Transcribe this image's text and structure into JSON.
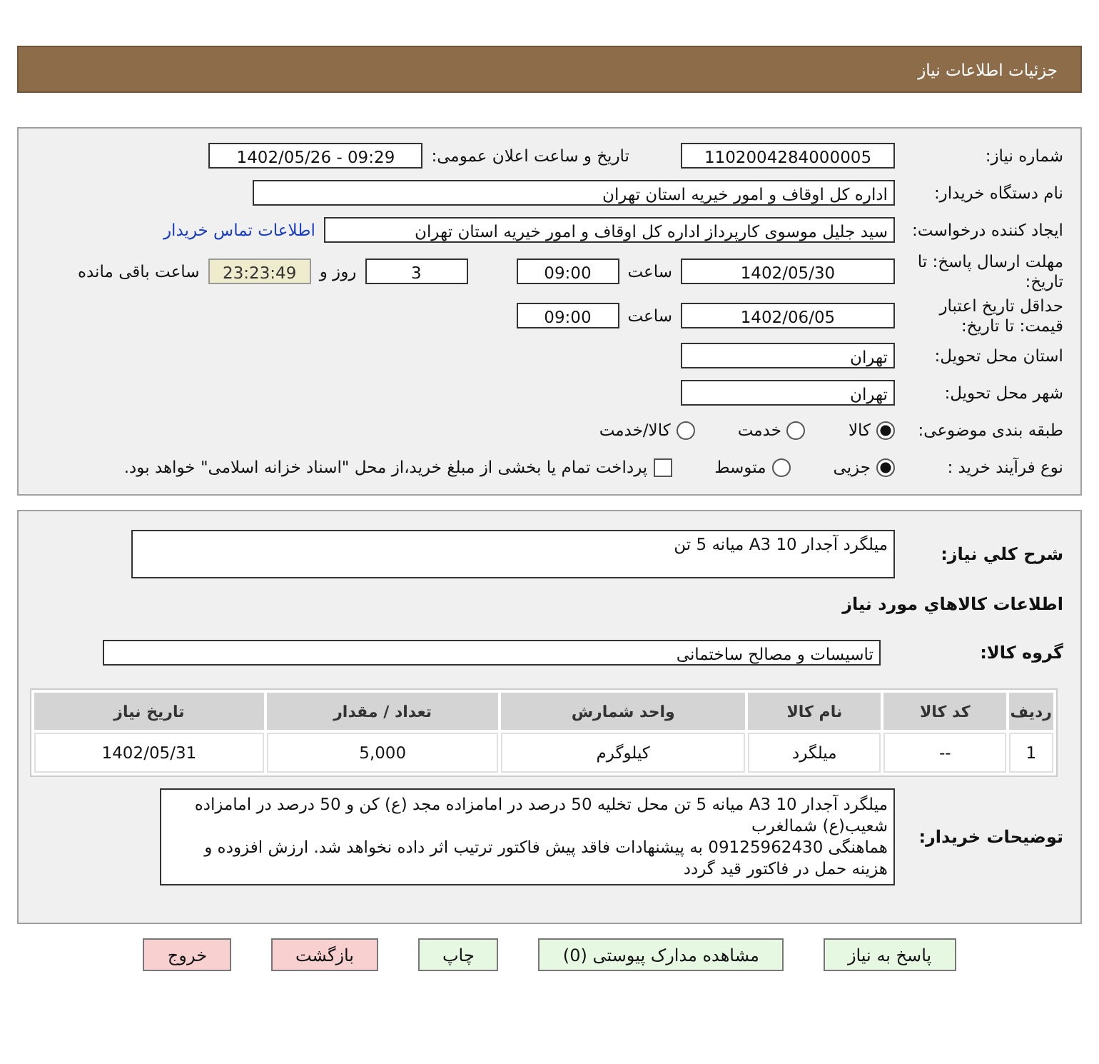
{
  "header": {
    "title": "جزئیات اطلاعات نیاز"
  },
  "details": {
    "need_number": {
      "label": "شماره نیاز:",
      "value": "1102004284000005"
    },
    "announce": {
      "label": "تاریخ و ساعت اعلان عمومی:",
      "value": "1402/05/26 - 09:29"
    },
    "buyer": {
      "label": "نام دستگاه خریدار:",
      "value": "اداره کل اوقاف و امور خیریه استان تهران"
    },
    "requester": {
      "label": "ایجاد کننده درخواست:",
      "value": "سید جلیل موسوی کارپرداز اداره کل اوقاف و امور خیریه استان تهران",
      "link": "اطلاعات تماس خریدار"
    },
    "deadline": {
      "label": "مهلت ارسال پاسخ: تا تاریخ:",
      "date": "1402/05/30",
      "time_label": "ساعت",
      "time": "09:00",
      "days": "3",
      "days_label": "روز و",
      "remaining": "23:23:49",
      "remaining_label": "ساعت باقی مانده"
    },
    "validity": {
      "label": "حداقل تاریخ اعتبار قیمت: تا تاریخ:",
      "date": "1402/06/05",
      "time_label": "ساعت",
      "time": "09:00"
    },
    "province": {
      "label": "استان محل تحویل:",
      "value": "تهران"
    },
    "city": {
      "label": "شهر محل تحویل:",
      "value": "تهران"
    },
    "category": {
      "label": "طبقه بندی موضوعی:",
      "options": [
        {
          "label": "کالا",
          "selected": true
        },
        {
          "label": "خدمت",
          "selected": false
        },
        {
          "label": "کالا/خدمت",
          "selected": false
        }
      ]
    },
    "process": {
      "label": "نوع فرآیند خرید :",
      "options": [
        {
          "label": "جزیی",
          "selected": true
        },
        {
          "label": "متوسط",
          "selected": false
        }
      ],
      "payment": {
        "label": "پرداخت تمام یا بخشی از مبلغ خرید،از محل \"اسناد خزانه اسلامی\" خواهد بود.",
        "checked": false
      }
    }
  },
  "summary": {
    "label": "شرح کلي نياز:",
    "value": "میلگرد آجدار A3 10   میانه 5 تن"
  },
  "items_title": "اطلاعات کالاهاي مورد نياز",
  "group": {
    "label": "گروه کالا:",
    "value": "تاسیسات و مصالح ساختمانی"
  },
  "table": {
    "columns": [
      "ردیف",
      "کد کالا",
      "نام کالا",
      "واحد شمارش",
      "تعداد / مقدار",
      "تاریخ نیاز"
    ],
    "rows": [
      [
        "1",
        "--",
        "میلگرد",
        "کیلوگرم",
        "5,000",
        "1402/05/31"
      ]
    ]
  },
  "buyer_notes": {
    "label": "توضیحات خریدار:",
    "value": "میلگرد آجدار A3 10   میانه 5 تن  محل تخلیه 50 درصد در امامزاده مجد (ع) کن و 50 درصد در امامزاده شعیب(ع) شمالغرب\nهماهنگی 09125962430 به پیشنهادات فاقد پیش فاکتور ترتیب اثر داده نخواهد شد. ارزش افزوده و هزینه حمل در فاکتور قید گردد"
  },
  "buttons": [
    {
      "label": "پاسخ به نیاز",
      "kind": "primary"
    },
    {
      "label": "مشاهده مدارک پیوستی (0)",
      "kind": "primary"
    },
    {
      "label": "چاپ",
      "kind": "primary"
    },
    {
      "label": "بازگشت",
      "kind": "danger"
    },
    {
      "label": "خروج",
      "kind": "danger"
    }
  ]
}
